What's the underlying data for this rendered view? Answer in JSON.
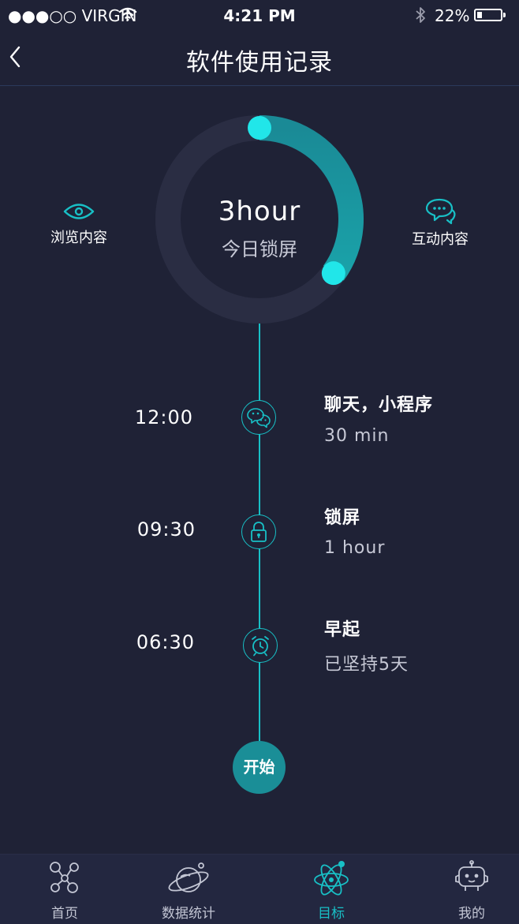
{
  "status_bar": {
    "carrier": "●●●○○ VIRGIN",
    "time": "4:21 PM",
    "battery_percent_text": "22%",
    "battery_level": 0.22
  },
  "nav": {
    "title": "软件使用记录",
    "back_icon": "chevron-left-icon"
  },
  "summary": {
    "value": "3hour",
    "caption": "今日锁屏",
    "ring_progress": 0.35,
    "left_feature": {
      "label": "浏览内容",
      "icon": "eye-icon"
    },
    "right_feature": {
      "label": "互动内容",
      "icon": "chat-bubble-icon"
    }
  },
  "timeline": [
    {
      "time": "12:00",
      "title": "聊天，小程序",
      "detail": "30 min",
      "icon": "wechat-icon"
    },
    {
      "time": "09:30",
      "title": "锁屏",
      "detail": "1 hour",
      "icon": "lock-icon"
    },
    {
      "time": "06:30",
      "title": "早起",
      "detail": "已坚持5天",
      "icon": "alarm-clock-icon"
    }
  ],
  "start_button": {
    "label": "开始"
  },
  "tabs": [
    {
      "label": "首页",
      "icon": "molecule-icon",
      "active": false
    },
    {
      "label": "数据统计",
      "icon": "planet-icon",
      "active": false
    },
    {
      "label": "目标",
      "icon": "atom-icon",
      "active": true
    },
    {
      "label": "我的",
      "icon": "robot-icon",
      "active": false
    }
  ],
  "colors": {
    "background": "#1f2236",
    "accent": "#18c0c6",
    "ring_track": "#2a2d43",
    "start_button": "#1a8e97",
    "text_secondary": "#c7c9d6"
  }
}
